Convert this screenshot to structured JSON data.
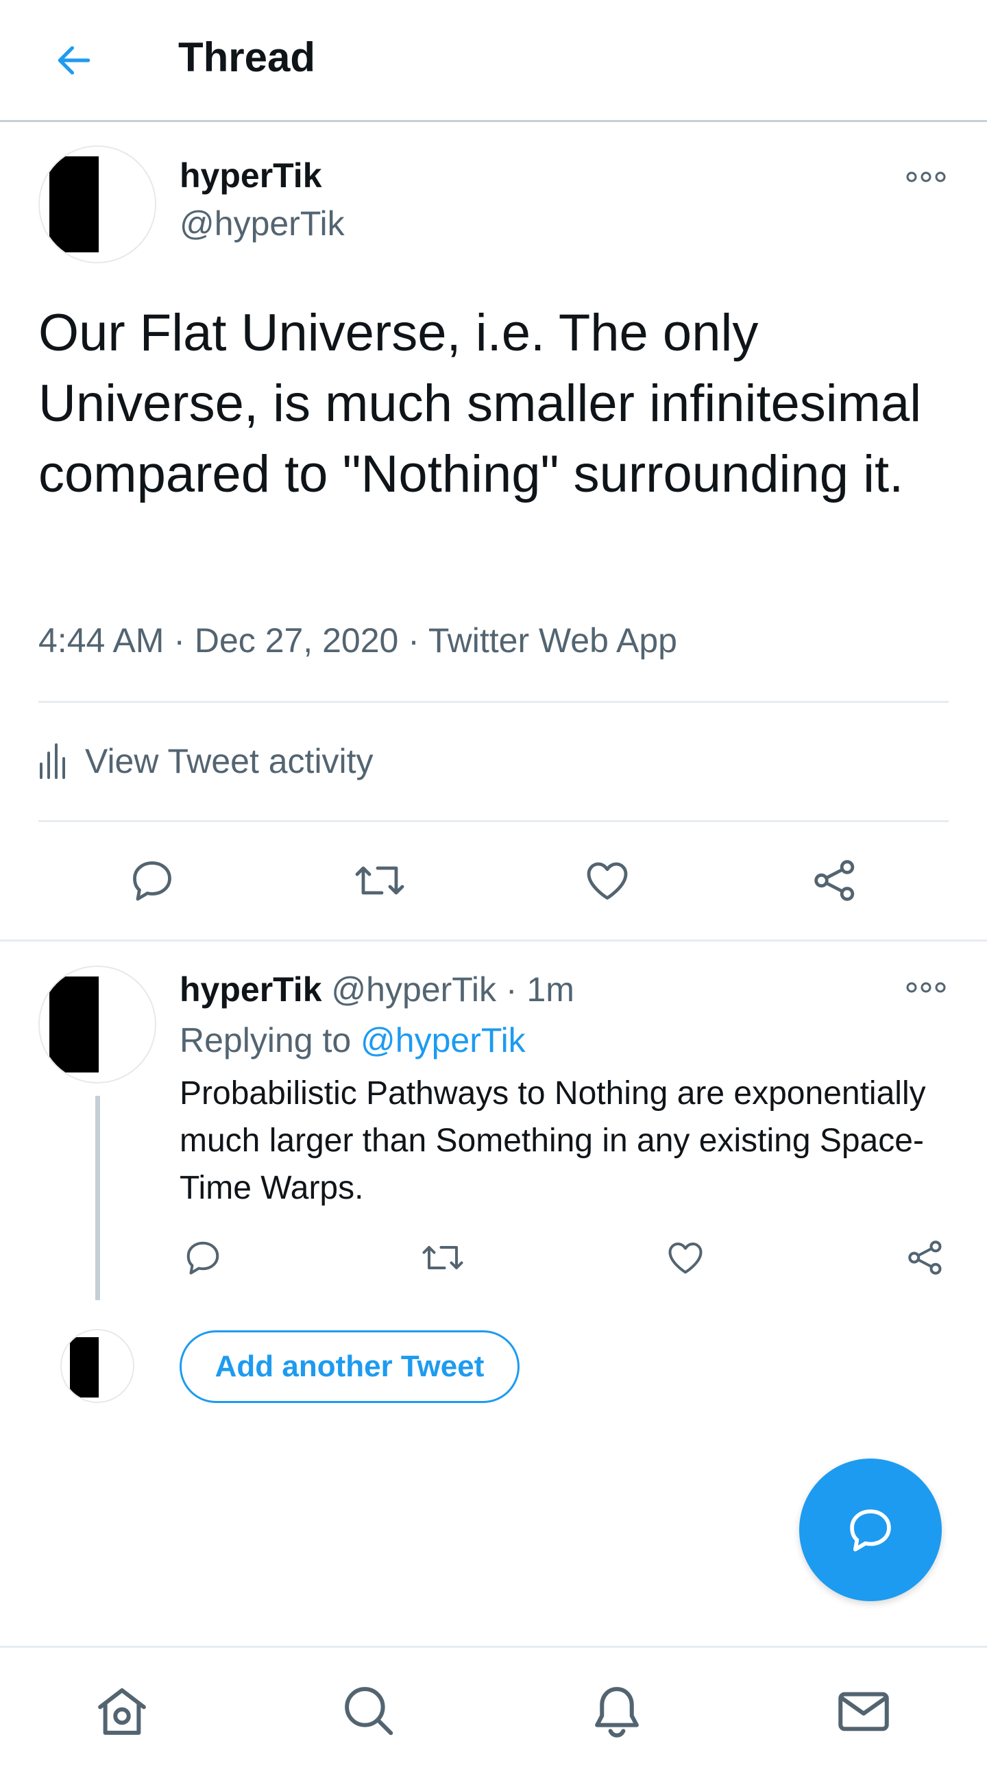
{
  "header": {
    "title": "Thread"
  },
  "main_tweet": {
    "display_name": "hyperTik",
    "handle": "@hyperTik",
    "text": "Our Flat Universe, i.e. The only Universe, is much smaller infinitesimal compared to \"Nothing\" surrounding it.",
    "meta": "4:44 AM · Dec 27, 2020 · Twitter Web App",
    "activity_label": "View Tweet activity"
  },
  "reply_tweet": {
    "display_name": "hyperTik",
    "handle_time": "@hyperTik · 1m",
    "replying_prefix": "Replying to ",
    "replying_to": "@hyperTik",
    "text": "Probabilistic Pathways to Nothing are exponentially much larger than Something in any existing Space-Time Warps."
  },
  "compose": {
    "add_label": "Add another Tweet"
  },
  "colors": {
    "accent": "#1d9bf0",
    "secondary_text": "#536471",
    "icon": "#536471",
    "divider": "#e6ecf0"
  },
  "icons": {
    "back": "arrow-left-icon",
    "more": "more-horizontal-icon",
    "activity": "bar-chart-icon",
    "reply": "reply-icon",
    "retweet": "retweet-icon",
    "like": "heart-icon",
    "share": "share-icon",
    "compose": "compose-icon",
    "home": "home-icon",
    "search": "search-icon",
    "notifications": "bell-icon",
    "messages": "mail-icon"
  }
}
